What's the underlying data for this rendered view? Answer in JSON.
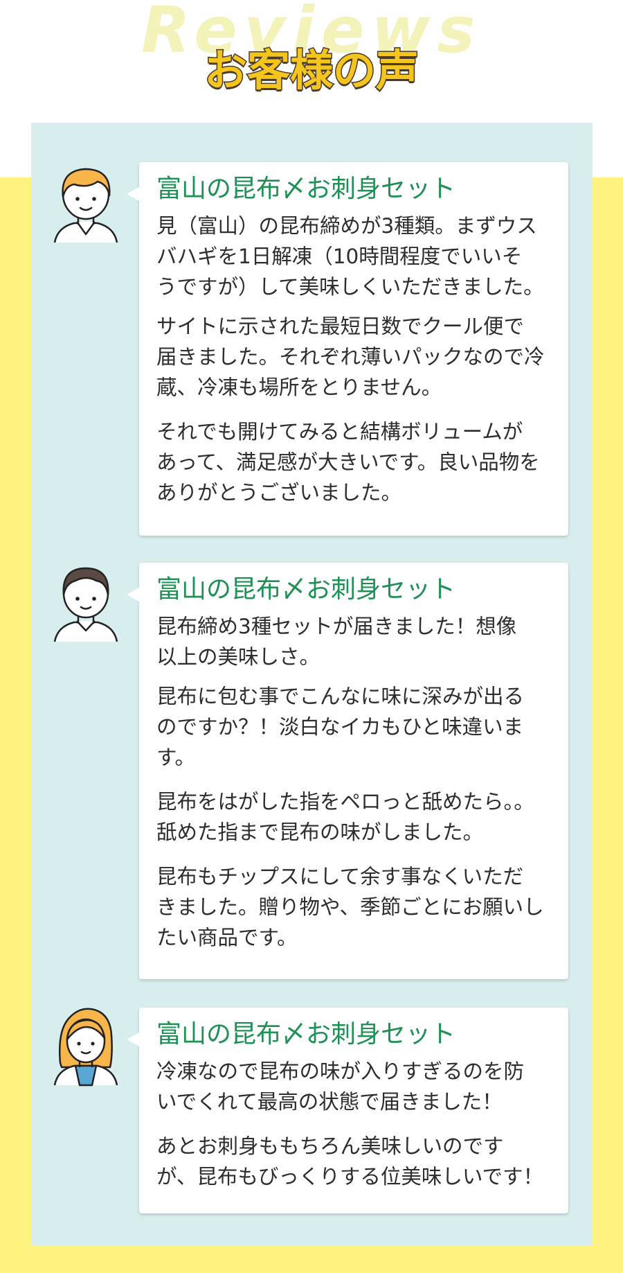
{
  "header": {
    "title_en": "Reviews",
    "title_jp": "お客様の声"
  },
  "colors": {
    "background_yellow": "#fff27e",
    "panel_teal": "#d8eeee",
    "title_green": "#1d9153",
    "header_yellow": "#f4c51c"
  },
  "reviews": [
    {
      "avatar": "man-orange-hair-icon",
      "title": "富山の昆布〆お刺身セット",
      "paragraphs": [
        [
          "見（富山）の昆布締めが3種類。まずウス",
          "バハギを1日解凍（10時間程度でいいそ",
          "うですが）して美味しくいただきました。"
        ],
        [
          "サイトに示された最短日数でクール便で",
          "届きました。それぞれ薄いパックなので冷",
          "蔵、冷凍も場所をとりません。"
        ],
        [
          "それでも開けてみると結構ボリュームが",
          "あって、満足感が大きいです。良い品物を",
          "ありがとうございました。"
        ]
      ]
    },
    {
      "avatar": "man-dark-hair-icon",
      "title": "富山の昆布〆お刺身セット",
      "paragraphs": [
        [
          "昆布締め3種セットが届きました！想像",
          "以上の美味しさ。"
        ],
        [
          "昆布に包む事でこんなに味に深みが出る",
          "のですか？！淡白なイカもひと味違いま",
          "す。"
        ],
        [
          "昆布をはがした指をペロっと舐めたら。。",
          "舐めた指まで昆布の味がしました。"
        ],
        [
          "昆布もチップスにして余す事なくいただ",
          "きました。贈り物や、季節ごとにお願いし",
          "たい商品です。"
        ]
      ]
    },
    {
      "avatar": "woman-orange-hair-icon",
      "title": "富山の昆布〆お刺身セット",
      "paragraphs": [
        [
          "冷凍なので昆布の味が入りすぎるのを防",
          "いでくれて最高の状態で届きました！"
        ],
        [
          "あとお刺身ももちろん美味しいのです",
          "が、昆布もびっくりする位美味しいです！"
        ]
      ]
    }
  ]
}
